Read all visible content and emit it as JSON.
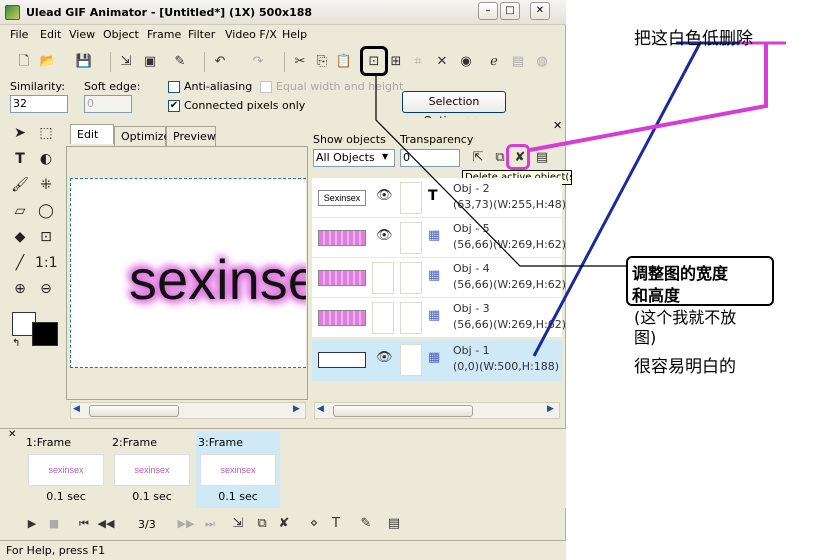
{
  "window": {
    "title": "Ulead GIF Animator - [Untitled*] (1X) 500x188",
    "controls": [
      "–",
      "□",
      "✕"
    ]
  },
  "menu": [
    "File",
    "Edit",
    "View",
    "Object",
    "Frame",
    "Filter",
    "Video F/X",
    "Help"
  ],
  "options": {
    "similarity_label": "Similarity:",
    "similarity_value": "32",
    "soft_edge_label": "Soft edge:",
    "soft_edge_value": "0",
    "anti_aliasing": "Anti-aliasing",
    "equal_wh": "Equal width and height",
    "connected_pixels": "Connected pixels only",
    "selection_options": "Selection Options>>"
  },
  "view_tabs": [
    "Edit",
    "Optimize",
    "Preview"
  ],
  "canvas_text": "sexinsex",
  "objects_panel": {
    "show_objects_label": "Show objects",
    "show_objects_value": "All Objects",
    "transparency_label": "Transparency",
    "transparency_value": "0",
    "tooltip": "Delete active object(s",
    "rows": [
      {
        "name": "Obj - 2",
        "coords": "(63,73)(W:255,H:48)",
        "type_glyph": "T",
        "thumb_text": "Sexinsex"
      },
      {
        "name": "Obj - 5",
        "coords": "(56,66)(W:269,H:62)",
        "type_glyph": "▦",
        "thumb_text": ""
      },
      {
        "name": "Obj - 4",
        "coords": "(56,66)(W:269,H:62)",
        "type_glyph": "▦",
        "thumb_text": ""
      },
      {
        "name": "Obj - 3",
        "coords": "(56,66)(W:269,H:62)",
        "type_glyph": "▦",
        "thumb_text": ""
      },
      {
        "name": "Obj - 1",
        "coords": "(0,0)(W:500,H:188)",
        "type_glyph": "▦",
        "thumb_text": ""
      }
    ]
  },
  "frames": [
    {
      "label": "1:Frame",
      "time": "0.1 sec",
      "thumb": "sexinsex"
    },
    {
      "label": "2:Frame",
      "time": "0.1 sec",
      "thumb": "sexinsex"
    },
    {
      "label": "3:Frame",
      "time": "0.1 sec",
      "thumb": "sexinsex"
    }
  ],
  "playback": {
    "counter": "3/3"
  },
  "status": "For Help, press F1",
  "annotations": {
    "top": "把这白色低删除",
    "callout_line1": "调整图的宽度",
    "callout_line2": "和高度",
    "note1": "(这个我就不放",
    "note2": "图)",
    "note3": "很容易明白的"
  },
  "colors": {
    "selection_blue": "#cfe9f7",
    "highlight_magenta": "#d63cd6",
    "line_blue": "#1a2aa0"
  }
}
